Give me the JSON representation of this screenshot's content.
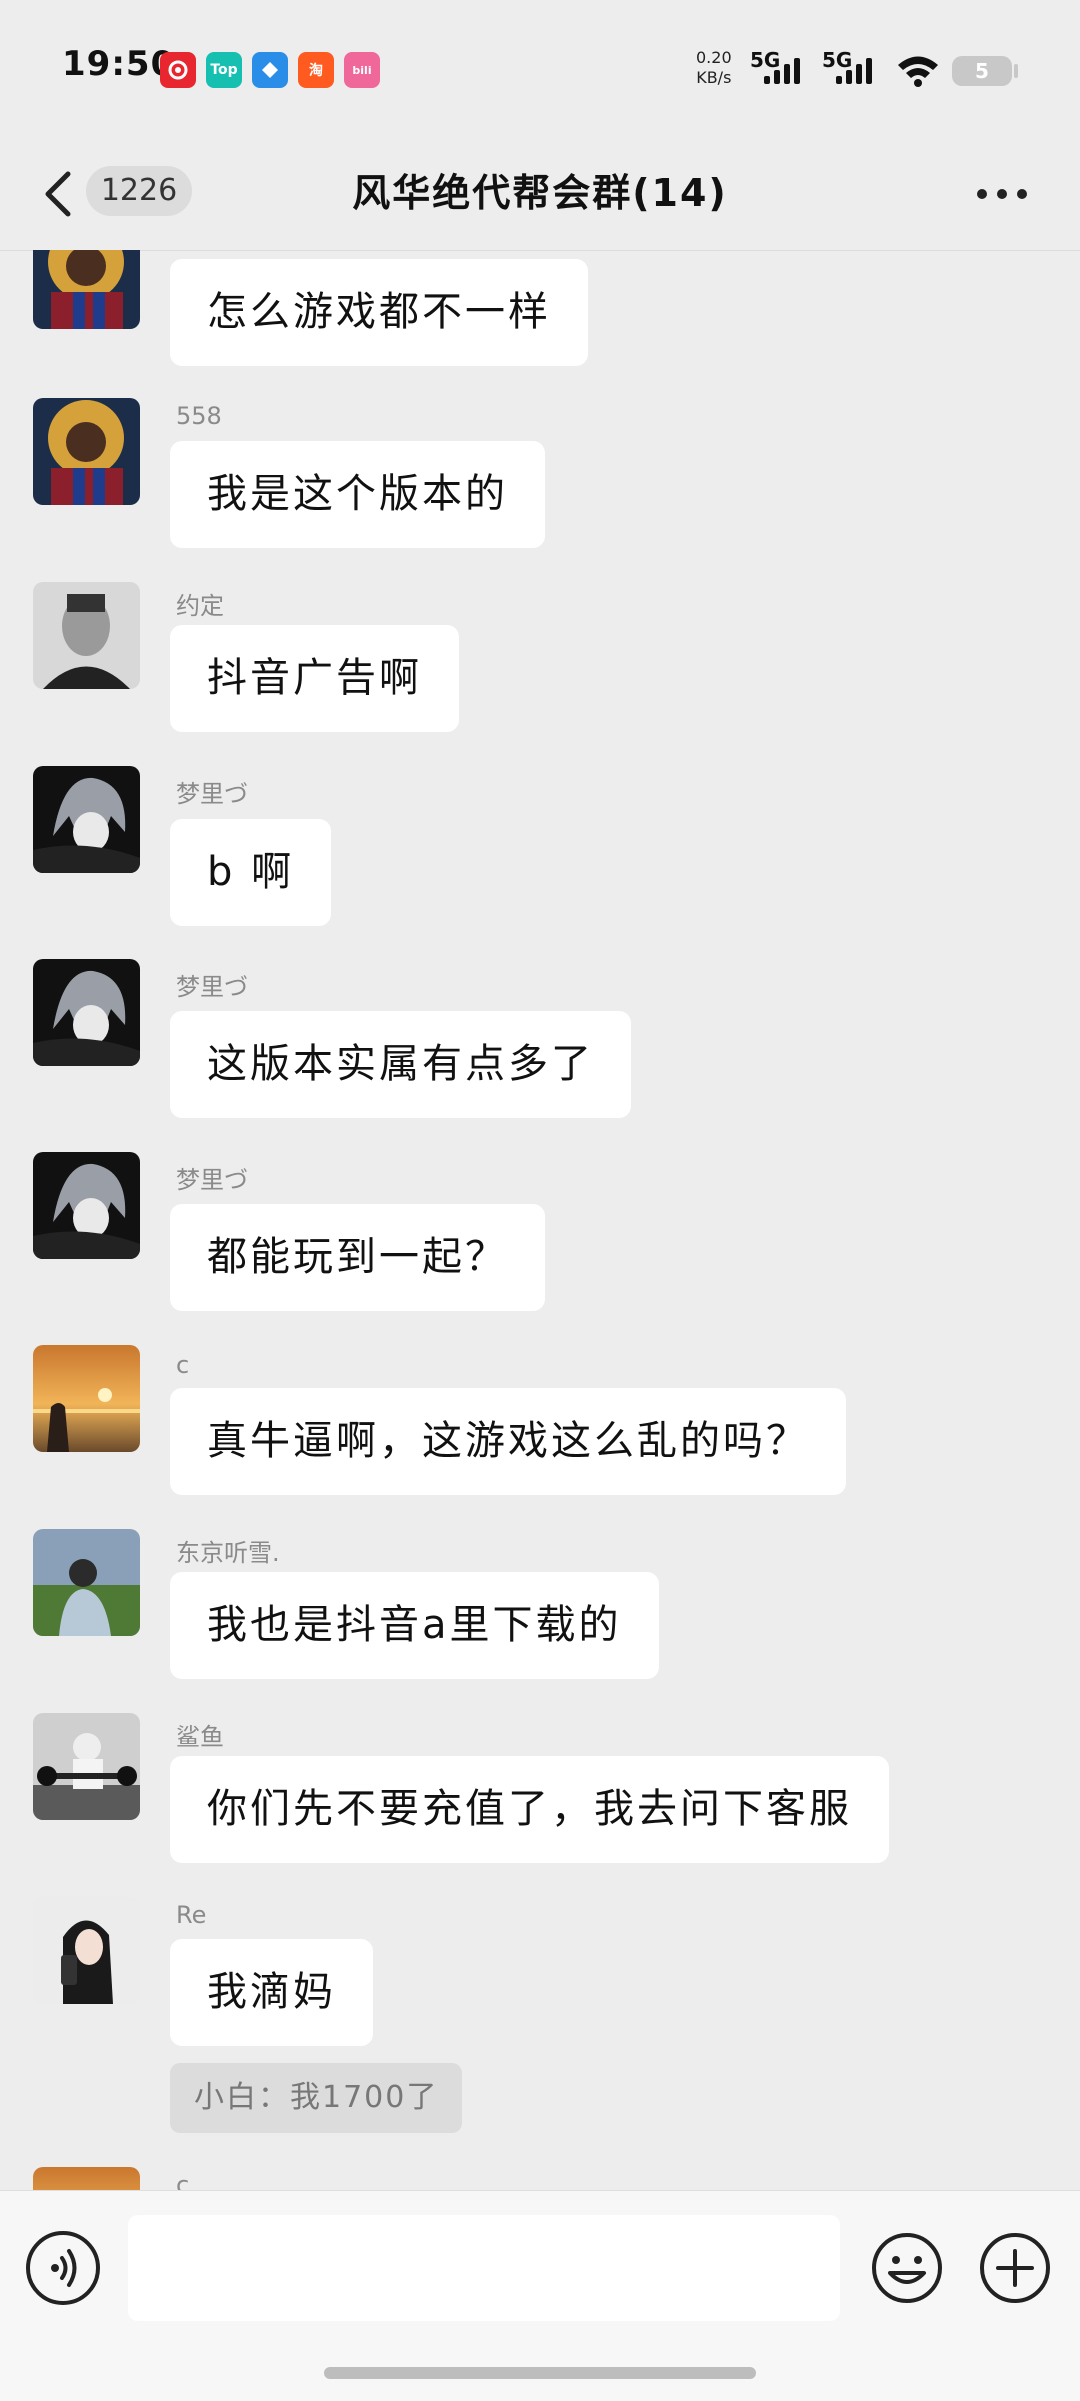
{
  "status": {
    "time": "19:50",
    "app_icons": [
      {
        "name": "netease-music-icon",
        "label": "",
        "color": "#e8262f"
      },
      {
        "name": "top-app-icon",
        "label": "Top",
        "color": "#16c0b0"
      },
      {
        "name": "blue-app-icon",
        "label": "",
        "color": "#2a8ee8"
      },
      {
        "name": "taobao-icon",
        "label": "淘",
        "color": "#ff5a1f"
      },
      {
        "name": "bilibili-icon",
        "label": "bili",
        "color": "#f0679a"
      }
    ],
    "net_speed_value": "0.20",
    "net_speed_unit": "KB/s",
    "signal_1": "5G",
    "signal_2": "5G",
    "battery": "5"
  },
  "header": {
    "unread_count": "1226",
    "title": "风华绝代帮会群(14)"
  },
  "messages": [
    {
      "sender": "",
      "text": "怎么游戏都不一样",
      "avatar": "avatar-football-player"
    },
    {
      "sender": "558",
      "text": "我是这个版本的",
      "avatar": "avatar-football-player"
    },
    {
      "sender": "约定",
      "text": "抖音广告啊",
      "avatar": "avatar-man-portrait"
    },
    {
      "sender": "梦里づ",
      "text": "b 啊",
      "avatar": "avatar-anime-boy"
    },
    {
      "sender": "梦里づ",
      "text": "这版本实属有点多了",
      "avatar": "avatar-anime-boy"
    },
    {
      "sender": "梦里づ",
      "text": "都能玩到一起？",
      "avatar": "avatar-anime-boy"
    },
    {
      "sender": "c",
      "text": "真牛逼啊，这游戏这么乱的吗？",
      "avatar": "avatar-sunset"
    },
    {
      "sender": "东京听雪.",
      "text": "我也是抖音a里下载的",
      "avatar": "avatar-field-boy"
    },
    {
      "sender": "鲨鱼",
      "text": "你们先不要充值了，我去问下客服",
      "avatar": "avatar-gym"
    },
    {
      "sender": "Re",
      "text": "我滴妈",
      "avatar": "avatar-selfie-girl"
    }
  ],
  "system_tip": "小白：我1700了",
  "partial_message": {
    "sender": "c",
    "avatar": "avatar-sunset"
  },
  "input": {
    "placeholder": "",
    "value": ""
  },
  "colors": {
    "background": "#ededed",
    "bubble": "#ffffff",
    "sender_text": "#8a8a8a",
    "input_bar": "#f7f7f7"
  }
}
